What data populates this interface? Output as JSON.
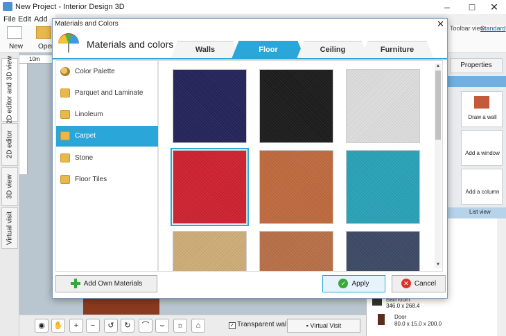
{
  "app": {
    "title": "New Project - Interior Design 3D",
    "menu": [
      "File",
      "Edit",
      "Add"
    ],
    "toolbar": {
      "new_label": "New",
      "open_label": "Open",
      "toolbar_view_label": "Toolbar view:",
      "toolbar_view_value": "Standard"
    },
    "side_tabs": [
      "2D editor and 3D view",
      "2D editor",
      "3D view",
      "Virtual visit"
    ],
    "ruler_label": "10m",
    "right_panel": {
      "properties_tab": "Properties",
      "draw_wall": "Draw a wall",
      "add_window": "Add a window",
      "add_column": "Add a column",
      "list_view": "List view",
      "items": [
        {
          "name": "Bathroom",
          "size": "346.0 x 268.4"
        },
        {
          "name": "Door",
          "size": "80.0 x 15.0 x 200.0"
        }
      ]
    },
    "bottom": {
      "transparent_walls": "Transparent walls",
      "virtual_visit": "Virtual Visit"
    }
  },
  "dialog": {
    "title": "Materials and Colors",
    "heading": "Materials and colors",
    "tabs": [
      {
        "label": "Walls",
        "active": false
      },
      {
        "label": "Floor",
        "active": true
      },
      {
        "label": "Ceiling",
        "active": false
      },
      {
        "label": "Furniture",
        "active": false
      }
    ],
    "categories": [
      {
        "label": "Color Palette",
        "icon": "palette-icon",
        "active": false
      },
      {
        "label": "Parquet and Laminate",
        "icon": "folder-icon",
        "active": false
      },
      {
        "label": "Linoleum",
        "icon": "folder-icon",
        "active": false
      },
      {
        "label": "Carpet",
        "icon": "folder-icon",
        "active": true
      },
      {
        "label": "Stone",
        "icon": "folder-icon",
        "active": false
      },
      {
        "label": "Floor Tiles",
        "icon": "folder-icon",
        "active": false
      }
    ],
    "swatches": [
      {
        "name": "navy-carpet",
        "color": "#24245a",
        "selected": false
      },
      {
        "name": "black-carpet",
        "color": "#1c1c1c",
        "selected": false
      },
      {
        "name": "light-gray-carpet",
        "color": "#dedede",
        "selected": false
      },
      {
        "name": "red-carpet",
        "color": "#cf2230",
        "selected": true
      },
      {
        "name": "terracotta-carpet",
        "color": "#c06a3e",
        "selected": false
      },
      {
        "name": "teal-carpet",
        "color": "#29a3b8",
        "selected": false
      },
      {
        "name": "beige-carpet",
        "color": "#cfae78",
        "selected": false
      },
      {
        "name": "copper-carpet",
        "color": "#b87048",
        "selected": false
      },
      {
        "name": "denim-carpet",
        "color": "#3d4a66",
        "selected": false
      }
    ],
    "buttons": {
      "add_own": "Add Own Materials",
      "apply": "Apply",
      "cancel": "Cancel"
    },
    "colors": {
      "accent": "#2aa6d8",
      "apply_icon": "#38a93a",
      "cancel_icon": "#d9342b"
    }
  }
}
